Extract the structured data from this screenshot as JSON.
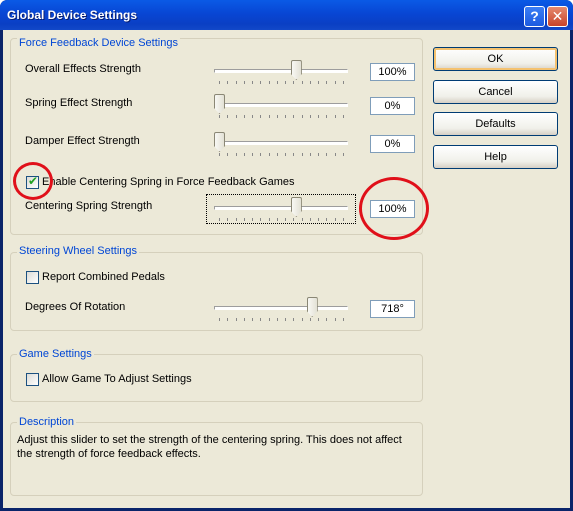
{
  "window": {
    "title": "Global Device Settings",
    "help_glyph": "?",
    "close_glyph": "✕"
  },
  "ffb": {
    "group_title": "Force Feedback Device Settings",
    "overall": {
      "label": "Overall Effects Strength",
      "value": "100%",
      "level": 0.63
    },
    "spring": {
      "label": "Spring Effect Strength",
      "value": "0%",
      "level": 0
    },
    "damper": {
      "label": "Damper Effect Strength",
      "value": "0%",
      "level": 0
    },
    "centering_checkbox": {
      "label": "Enable Centering Spring in Force Feedback Games",
      "checked": true
    },
    "centering": {
      "label": "Centering Spring Strength",
      "value": "100%",
      "level": 0.63
    }
  },
  "wheel": {
    "group_title": "Steering Wheel Settings",
    "combined_pedals": {
      "label": "Report Combined Pedals",
      "checked": false
    },
    "rotation": {
      "label": "Degrees Of Rotation",
      "value": "718°",
      "level": 0.76
    }
  },
  "game": {
    "group_title": "Game Settings",
    "allow_adjust": {
      "label": "Allow Game To Adjust Settings",
      "checked": false
    }
  },
  "description": {
    "group_title": "Description",
    "text": "Adjust this slider to set the strength of the centering spring. This does not affect the strength of force feedback effects."
  },
  "buttons": {
    "ok": "OK",
    "cancel": "Cancel",
    "defaults": "Defaults",
    "help": "Help"
  },
  "checkmark": "✔",
  "annotation_color": "#e0101a"
}
